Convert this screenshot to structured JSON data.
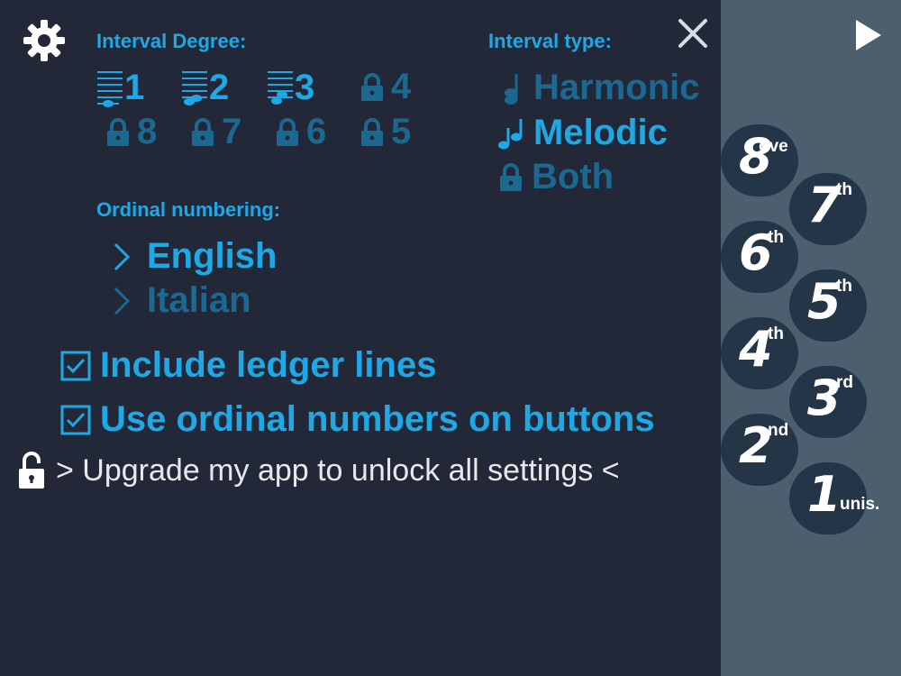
{
  "interval_degree": {
    "title": "Interval Degree:",
    "items": [
      "1",
      "2",
      "3",
      "4",
      "8",
      "7",
      "6",
      "5"
    ]
  },
  "interval_type": {
    "title": "Interval type:",
    "options": [
      "Harmonic",
      "Melodic",
      "Both"
    ]
  },
  "ordinal_numbering": {
    "title": "Ordinal numbering:",
    "options": [
      "English",
      "Italian"
    ]
  },
  "checkboxes": [
    "Include ledger lines",
    "Use ordinal numbers on buttons"
  ],
  "upgrade_text": "> Upgrade my app to unlock all settings <",
  "answer_buttons": [
    {
      "num": "8",
      "sup": "ove"
    },
    {
      "num": "7",
      "sup": "th"
    },
    {
      "num": "6",
      "sup": "th"
    },
    {
      "num": "5",
      "sup": "th"
    },
    {
      "num": "4",
      "sup": "th"
    },
    {
      "num": "3",
      "sup": "rd"
    },
    {
      "num": "2",
      "sup": "nd"
    },
    {
      "num": "1",
      "sup": "unis."
    }
  ],
  "colors": {
    "accent": "#1fa8e6",
    "accent_dim": "#1b6890",
    "panel_bg": "#232839",
    "side_bg": "#4b5f6e"
  },
  "icons": [
    "gear-icon",
    "close-icon",
    "play-icon",
    "lock-icon",
    "unlock-icon",
    "staff-note-icon",
    "checkbox-icon",
    "chevron-right-icon"
  ]
}
